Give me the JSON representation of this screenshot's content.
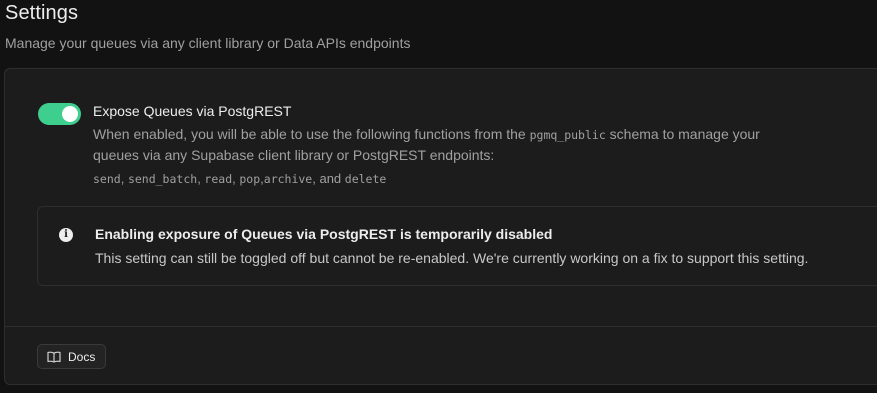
{
  "header": {
    "title": "Settings",
    "subtitle": "Manage your queues via any client library or Data APIs endpoints"
  },
  "expose_setting": {
    "enabled": true,
    "label": "Expose Queues via PostgREST",
    "desc_before": "When enabled, you will be able to use the following functions from the ",
    "desc_code": "pgmq_public",
    "desc_after": " schema to manage your queues via any Supabase client library or PostgREST endpoints:",
    "functions": {
      "send": "send",
      "sep1": ", ",
      "send_batch": "send_batch",
      "sep2": ", ",
      "read": "read",
      "sep3": ", ",
      "pop": "pop",
      "sep4": ",",
      "archive": "archive",
      "sep5": ", and ",
      "delete": "delete"
    }
  },
  "alert": {
    "icon": "info-icon",
    "title": "Enabling exposure of Queues via PostgREST is temporarily disabled",
    "body": "This setting can still be toggled off but cannot be re-enabled. We're currently working on a fix to support this setting."
  },
  "footer": {
    "docs_label": "Docs",
    "docs_icon": "book-open-icon"
  },
  "colors": {
    "accent": "#3ecf8e",
    "background": "#121212",
    "card": "#1c1c1c",
    "border": "#2e2e2e"
  }
}
